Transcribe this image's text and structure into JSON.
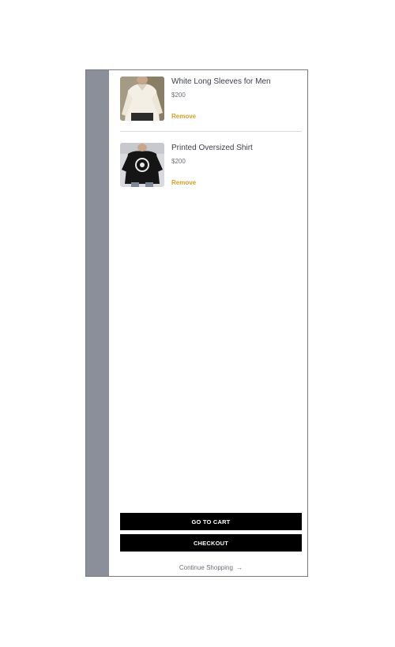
{
  "cart": {
    "items": [
      {
        "name": "White Long Sleeves for Men",
        "price": "$200",
        "remove_label": "Remove"
      },
      {
        "name": "Printed Oversized Shirt",
        "price": "$200",
        "remove_label": "Remove"
      }
    ]
  },
  "actions": {
    "go_to_cart_label": "GO TO CART",
    "checkout_label": "CHECKOUT",
    "continue_label": "Continue Shopping",
    "continue_arrow": "→"
  },
  "colors": {
    "overlay": "#8b8f99",
    "remove_accent": "#d4a027",
    "button_bg": "#000000"
  },
  "icons": {
    "continue": "arrow-right-icon"
  }
}
